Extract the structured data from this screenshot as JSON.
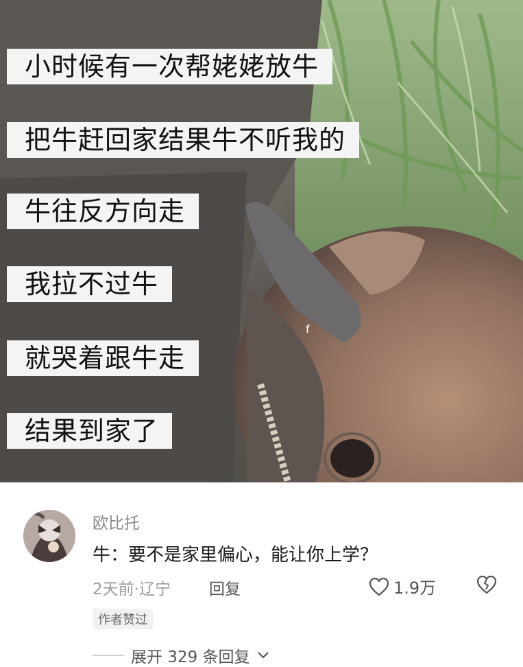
{
  "media": {
    "captions": [
      "小时候有一次帮姥姥放牛",
      "把牛赶回家结果牛不听我的",
      "牛往反方向走",
      "我拉不过牛",
      "就哭着跟牛走",
      "结果到家了"
    ],
    "overlay_glyph": "f"
  },
  "comment": {
    "username": "欧比托",
    "text": "牛：要不是家里偏心，能让你上学？",
    "meta": "2天前·辽宁",
    "reply_label": "回复",
    "like_count": "1.9万",
    "badge": "作者赞过",
    "expand_label": "展开 329 条回复",
    "like_icon": "heart-outline-icon",
    "dislike_icon": "broken-heart-icon",
    "expand_icon": "chevron-down-icon"
  }
}
